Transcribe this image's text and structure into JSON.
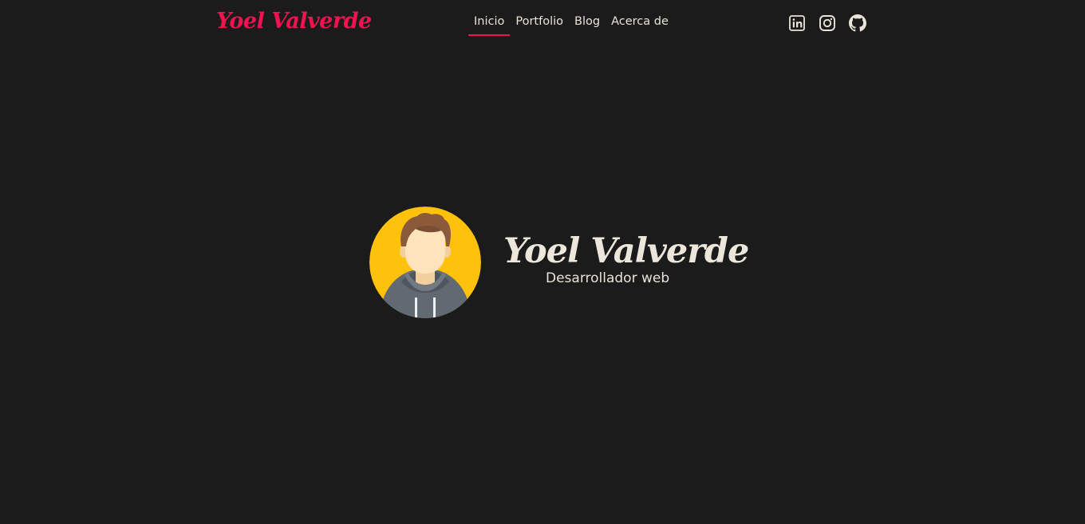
{
  "header": {
    "logo": "Yoel Valverde",
    "nav": [
      {
        "label": "Inicio",
        "active": true
      },
      {
        "label": "Portfolio",
        "active": false
      },
      {
        "label": "Blog",
        "active": false
      },
      {
        "label": "Acerca de",
        "active": false
      }
    ],
    "socials": [
      {
        "icon": "linkedin-icon"
      },
      {
        "icon": "instagram-icon"
      },
      {
        "icon": "github-icon"
      }
    ]
  },
  "hero": {
    "name": "Yoel Valverde",
    "role": "Desarrollador web",
    "avatar_icon": "developer-avatar"
  },
  "colors": {
    "background": "#1b1b1b",
    "accent": "#f0134f",
    "text": "#e9e3d8",
    "avatar_bg": "#fec20c"
  }
}
